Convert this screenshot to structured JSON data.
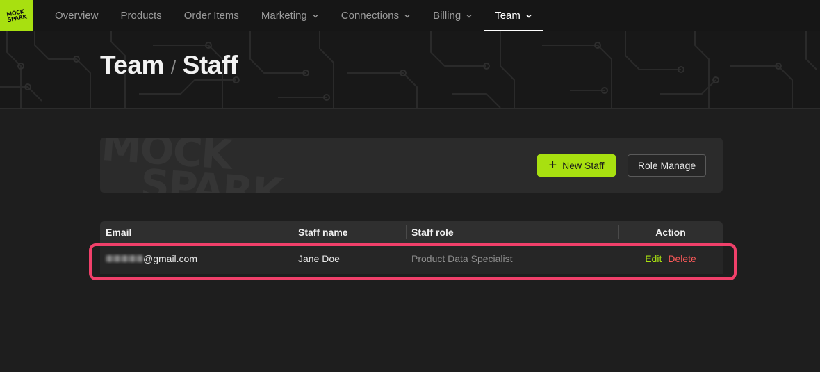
{
  "brand": {
    "logo_line1": "MOCK",
    "logo_line2": "SPARK",
    "accent": "#a8e010"
  },
  "nav": {
    "items": [
      {
        "label": "Overview",
        "dropdown": false,
        "active": false
      },
      {
        "label": "Products",
        "dropdown": false,
        "active": false
      },
      {
        "label": "Order Items",
        "dropdown": false,
        "active": false
      },
      {
        "label": "Marketing",
        "dropdown": true,
        "active": false
      },
      {
        "label": "Connections",
        "dropdown": true,
        "active": false
      },
      {
        "label": "Billing",
        "dropdown": true,
        "active": false
      },
      {
        "label": "Team",
        "dropdown": true,
        "active": true
      }
    ]
  },
  "breadcrumb": {
    "parent": "Team",
    "separator": "/",
    "current": "Staff"
  },
  "actions": {
    "watermark_line1": "MOCK",
    "watermark_line2": "SPARK",
    "new_staff_label": "New Staff",
    "role_manage_label": "Role Manage"
  },
  "table": {
    "columns": [
      "Email",
      "Staff name",
      "Staff role",
      "Action"
    ],
    "rows": [
      {
        "email_domain": "@gmail.com",
        "name": "Jane Doe",
        "role": "Product Data Specialist",
        "edit_label": "Edit",
        "delete_label": "Delete"
      }
    ]
  },
  "colors": {
    "edit": "#a8e010",
    "delete": "#ff5a5a",
    "highlight": "#f0406a"
  }
}
